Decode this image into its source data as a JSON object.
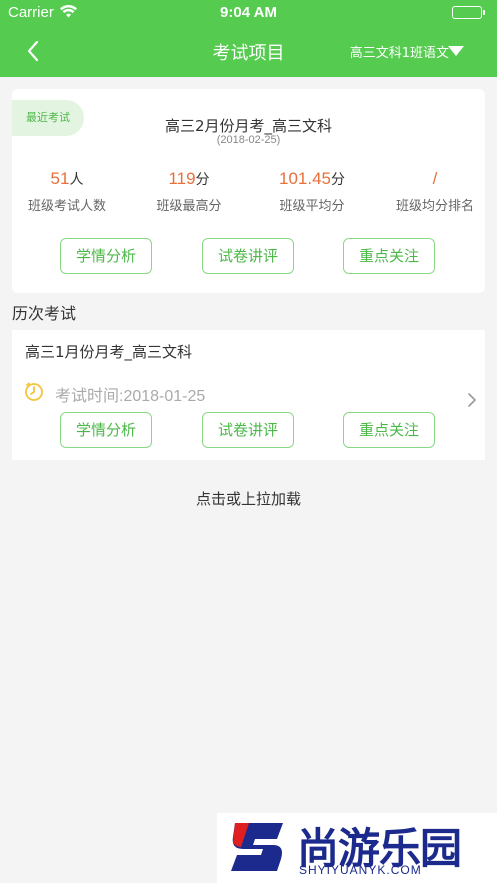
{
  "status_bar": {
    "carrier": "Carrier",
    "time": "9:04 AM"
  },
  "nav": {
    "title": "考试项目",
    "class_selector": "高三文科1班语文"
  },
  "latest_exam": {
    "tag": "最近考试",
    "title": "高三2月份月考_高三文科",
    "date": "(2018-02-25)",
    "stats": [
      {
        "value": "51",
        "unit": "人",
        "label": "班级考试人数"
      },
      {
        "value": "119",
        "unit": "分",
        "label": "班级最高分"
      },
      {
        "value": "101.45",
        "unit": "分",
        "label": "班级平均分"
      },
      {
        "value": "/",
        "unit": "",
        "label": "班级均分排名"
      }
    ],
    "buttons": [
      "学情分析",
      "试卷讲评",
      "重点关注"
    ]
  },
  "history": {
    "section_title": "历次考试",
    "items": [
      {
        "title": "高三1月份月考_高三文科",
        "time": "考试时间:2018-01-25",
        "buttons": [
          "学情分析",
          "试卷讲评",
          "重点关注"
        ]
      }
    ]
  },
  "load_more": "点击或上拉加载",
  "watermark": {
    "text": "尚游乐园",
    "sub": "SHYIYUANYK.COM"
  },
  "colors": {
    "accent": "#55cc4f",
    "stat_number": "#e8703a",
    "button_text": "#4cb848",
    "watermark": "#1b2a8c"
  }
}
